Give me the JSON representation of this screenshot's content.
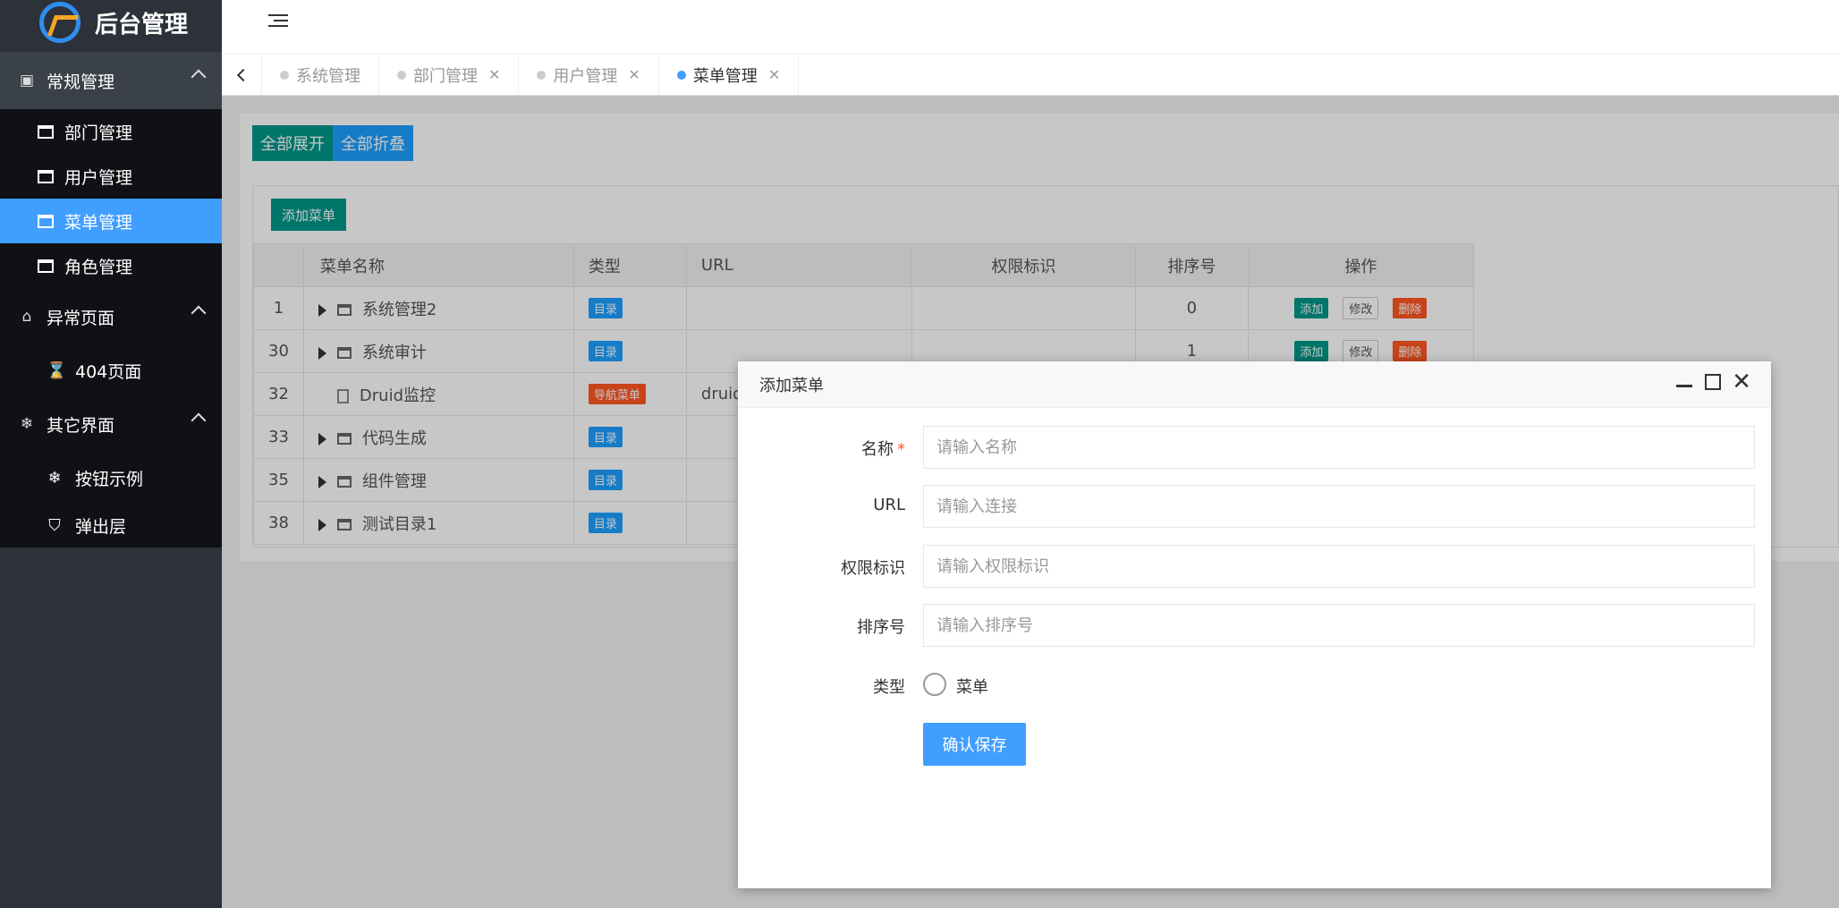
{
  "sidebar": {
    "logo_title": "后台管理",
    "groups": [
      {
        "label": "常规管理",
        "items": [
          {
            "label": "部门管理"
          },
          {
            "label": "用户管理"
          },
          {
            "label": "菜单管理"
          },
          {
            "label": "角色管理"
          }
        ]
      },
      {
        "label": "异常页面",
        "items": [
          {
            "label": "404页面"
          }
        ]
      },
      {
        "label": "其它界面",
        "items": [
          {
            "label": "按钮示例"
          },
          {
            "label": "弹出层"
          }
        ]
      }
    ]
  },
  "tabs": [
    {
      "label": "系统管理"
    },
    {
      "label": "部门管理"
    },
    {
      "label": "用户管理"
    },
    {
      "label": "菜单管理"
    }
  ],
  "toolbar": {
    "expand_all": "全部展开",
    "collapse_all": "全部折叠",
    "add_menu": "添加菜单"
  },
  "table": {
    "headers": {
      "name": "菜单名称",
      "type": "类型",
      "url": "URL",
      "perm": "权限标识",
      "sort": "排序号",
      "op": "操作"
    },
    "rows": [
      {
        "id": "1",
        "name": "系统管理2",
        "type": "目录",
        "url": "",
        "perm": "",
        "sort": "0"
      },
      {
        "id": "30",
        "name": "系统审计",
        "type": "目录",
        "url": "",
        "perm": "",
        "sort": "1"
      },
      {
        "id": "32",
        "name": "Druid监控",
        "type": "导航菜单",
        "url": "druid/i",
        "perm": "",
        "sort": ""
      },
      {
        "id": "33",
        "name": "代码生成",
        "type": "目录",
        "url": "",
        "perm": "",
        "sort": ""
      },
      {
        "id": "35",
        "name": "组件管理",
        "type": "目录",
        "url": "",
        "perm": "",
        "sort": ""
      },
      {
        "id": "38",
        "name": "测试目录1",
        "type": "目录",
        "url": "",
        "perm": "",
        "sort": ""
      }
    ],
    "ops": {
      "add": "添加",
      "edit": "修改",
      "del": "删除"
    }
  },
  "modal": {
    "title": "添加菜单",
    "fields": {
      "name": {
        "label": "名称",
        "required": "*",
        "placeholder": "请输入名称"
      },
      "url": {
        "label": "URL",
        "placeholder": "请输入连接"
      },
      "perm": {
        "label": "权限标识",
        "placeholder": "请输入权限标识"
      },
      "sort": {
        "label": "排序号",
        "placeholder": "请输入排序号"
      },
      "type": {
        "label": "类型",
        "option": "菜单"
      }
    },
    "save": "确认保存"
  }
}
